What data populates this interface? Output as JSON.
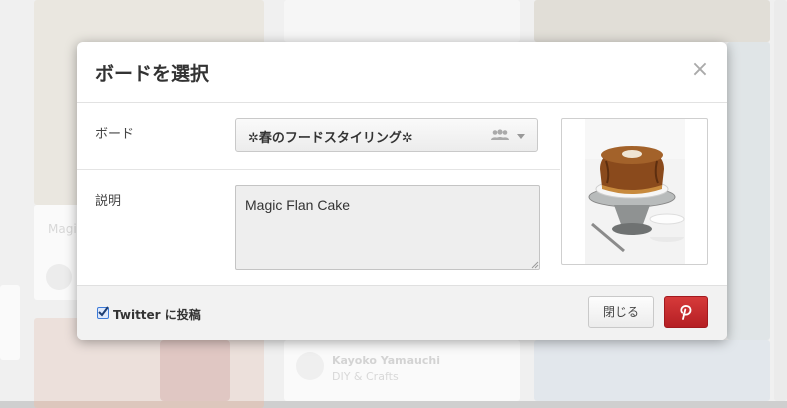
{
  "modal": {
    "title": "ボードを選択",
    "close_glyph": "×",
    "board_label": "ボード",
    "board_selected": "✲春のフードスタイリング✲",
    "description_label": "説明",
    "description_value": "Magic Flan Cake",
    "twitter_label": "Twitter に投稿",
    "twitter_checked": true,
    "close_button_label": "閉じる",
    "pin_button_icon": "pinterest-p-icon"
  },
  "background": {
    "pin_text_fragment": "Magi",
    "pinner_name": "Kayoko Yamauchi",
    "pinner_board": "DIY & Crafts"
  }
}
